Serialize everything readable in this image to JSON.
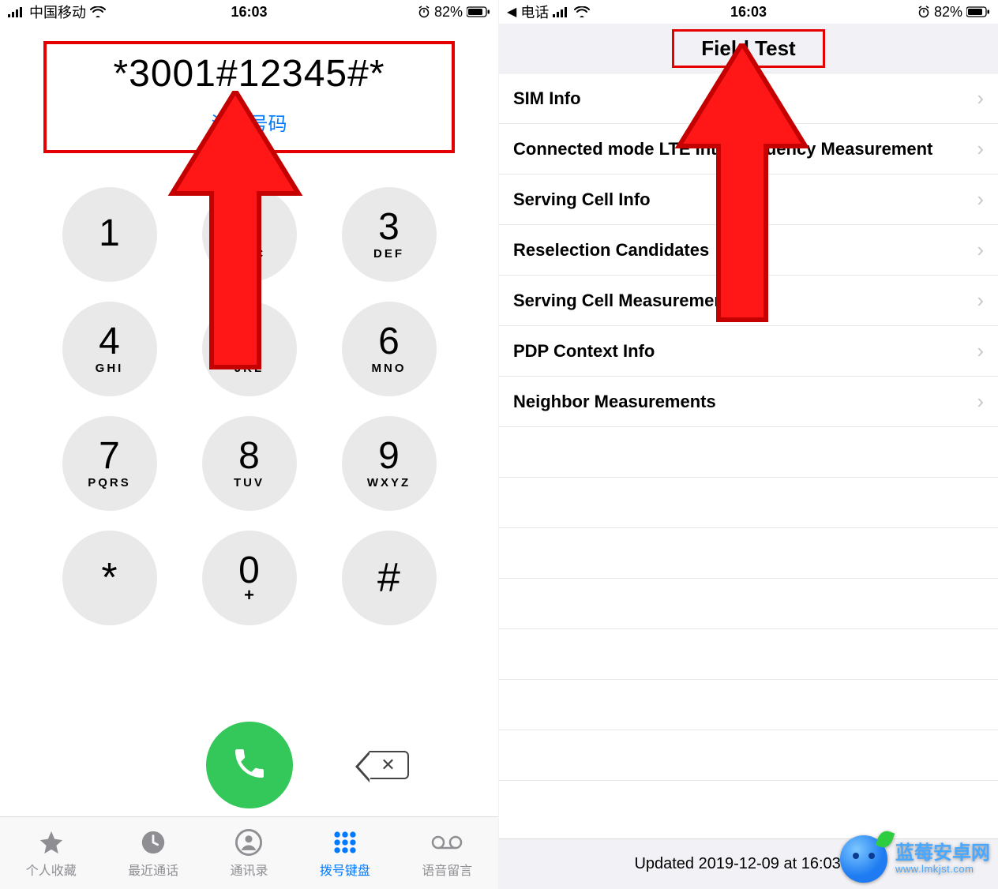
{
  "left": {
    "status": {
      "carrier": "中国移动",
      "time": "16:03",
      "battery": "82%"
    },
    "dial": {
      "entered": "*3001#12345#*",
      "add_number": "添加号码"
    },
    "keys": [
      {
        "digit": "1",
        "letters": ""
      },
      {
        "digit": "2",
        "letters": "ABC"
      },
      {
        "digit": "3",
        "letters": "DEF"
      },
      {
        "digit": "4",
        "letters": "GHI"
      },
      {
        "digit": "5",
        "letters": "JKL"
      },
      {
        "digit": "6",
        "letters": "MNO"
      },
      {
        "digit": "7",
        "letters": "PQRS"
      },
      {
        "digit": "8",
        "letters": "TUV"
      },
      {
        "digit": "9",
        "letters": "WXYZ"
      },
      {
        "digit": "*",
        "letters": ""
      },
      {
        "digit": "0",
        "letters": "+"
      },
      {
        "digit": "#",
        "letters": ""
      }
    ],
    "tabs": {
      "favorites": "个人收藏",
      "recents": "最近通话",
      "contacts": "通讯录",
      "keypad": "拨号键盘",
      "voicemail": "语音留言"
    }
  },
  "right": {
    "status": {
      "back": "电话",
      "time": "16:03",
      "battery": "82%"
    },
    "title": "Field Test",
    "rows": [
      "SIM Info",
      "Connected mode LTE Intrafrequency Measurement",
      "Serving Cell Info",
      "Reselection Candidates",
      "Serving Cell Measurements",
      "PDP Context Info",
      "Neighbor Measurements"
    ],
    "updated": "Updated 2019-12-09 at 16:03:23"
  },
  "watermark": {
    "title": "蓝莓安卓网",
    "url": "www.lmkjst.com"
  }
}
